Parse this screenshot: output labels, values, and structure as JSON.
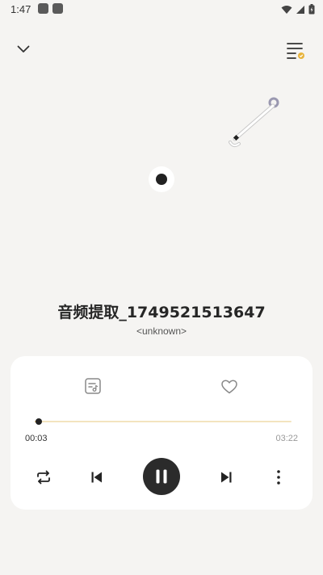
{
  "status_bar": {
    "time": "1:47"
  },
  "header": {
    "collapse_icon": "chevron-down-icon",
    "queue_icon": "playlist-queue-icon"
  },
  "song": {
    "title": "音频提取_1749521513647",
    "artist": "<unknown>"
  },
  "player": {
    "lyrics_icon": "lyrics-icon",
    "favorite_icon": "heart-icon",
    "current_time": "00:03",
    "total_time": "03:22",
    "progress_fraction": 0.015,
    "accent_color": "#e8c98e",
    "controls": {
      "repeat_icon": "repeat-icon",
      "prev_icon": "skip-previous-icon",
      "play_pause_icon": "pause-icon",
      "next_icon": "skip-next-icon",
      "more_icon": "more-vertical-icon"
    }
  }
}
